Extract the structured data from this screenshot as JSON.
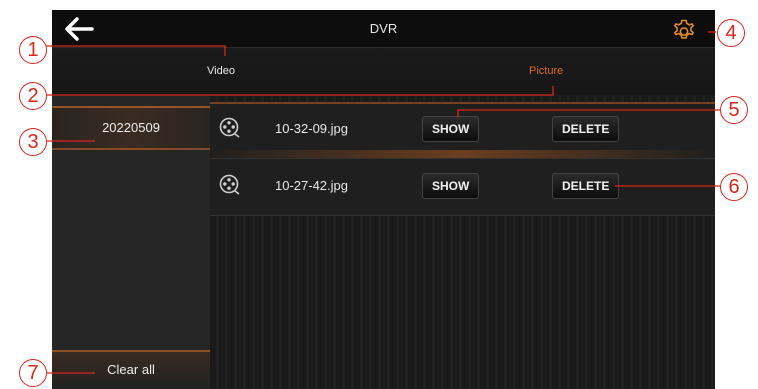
{
  "header": {
    "title": "DVR",
    "back_icon": "back-arrow-icon",
    "settings_icon": "gear-icon"
  },
  "tabs": [
    {
      "label": "Video",
      "active": false
    },
    {
      "label": "Picture",
      "active": true,
      "color": "#e06a2c"
    }
  ],
  "sidebar": {
    "dates": [
      {
        "label": "20220509",
        "selected": true
      }
    ],
    "clear_all_label": "Clear all"
  },
  "files": [
    {
      "icon": "film-reel-icon",
      "name": "10-32-09.jpg",
      "show_label": "SHOW",
      "delete_label": "DELETE"
    },
    {
      "icon": "film-reel-icon",
      "name": "10-27-42.jpg",
      "show_label": "SHOW",
      "delete_label": "DELETE"
    }
  ],
  "callouts": [
    "1",
    "2",
    "3",
    "4",
    "5",
    "6",
    "7"
  ],
  "colors": {
    "accent": "#e06a2c",
    "callout": "#d9261c",
    "background": "#1c1c1c"
  }
}
